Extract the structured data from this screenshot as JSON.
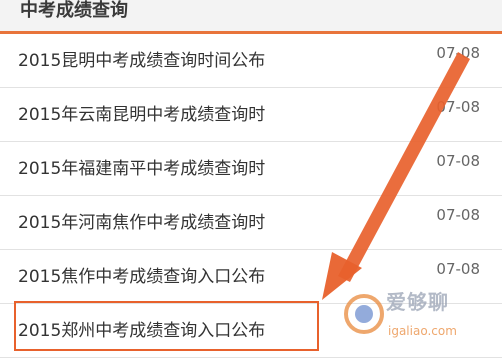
{
  "section": {
    "title": "中考成绩查询"
  },
  "news": [
    {
      "title": "2015昆明中考成绩查询时间公布",
      "date": "07-08"
    },
    {
      "title": "2015年云南昆明中考成绩查询时",
      "date": "07-08"
    },
    {
      "title": "2015年福建南平中考成绩查询时",
      "date": "07-08"
    },
    {
      "title": "2015年河南焦作中考成绩查询时",
      "date": "07-08"
    },
    {
      "title": "2015焦作中考成绩查询入口公布",
      "date": "07-08"
    },
    {
      "title": "2015郑州中考成绩查询入口公布",
      "date": ""
    }
  ],
  "colors": {
    "accent": "#e8743b",
    "annotation": "#e8612c"
  },
  "watermark": {
    "brand": "爱够聊",
    "url": "igaliao.com"
  }
}
